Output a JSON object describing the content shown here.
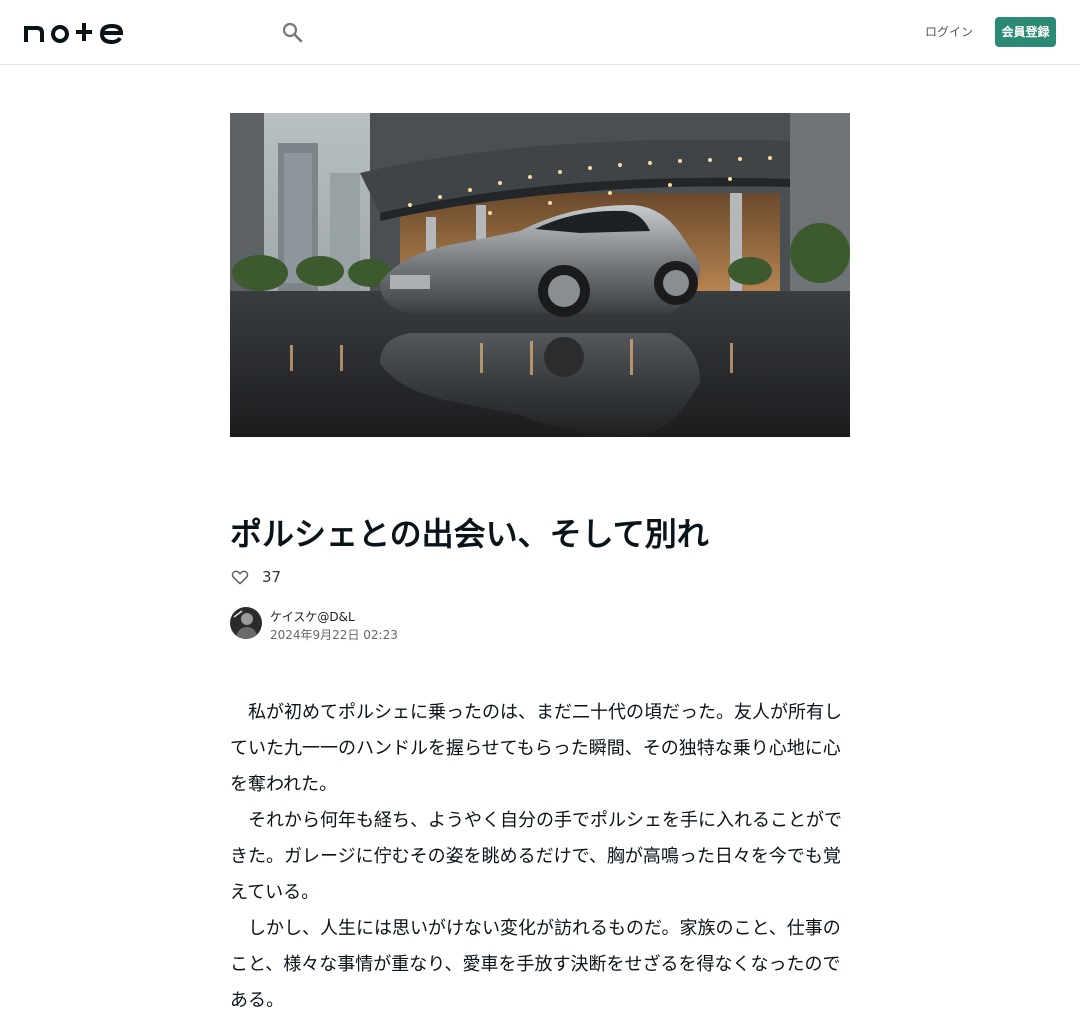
{
  "header": {
    "logo_text": "note",
    "login_label": "ログイン",
    "signup_label": "会員登録"
  },
  "article": {
    "title": "ポルシェとの出会い、そして別れ",
    "likes": "37",
    "author_name": "ケイスケ@D&L",
    "date": "2024年9月22日 02:23",
    "paragraphs": [
      "私が初めてポルシェに乗ったのは、まだ二十代の頃だった。友人が所有していた九一一のハンドルを握らせてもらった瞬間、その独特な乗り心地に心を奪われた。",
      "それから何年も経ち、ようやく自分の手でポルシェを手に入れることができた。ガレージに佇むその姿を眺めるだけで、胸が高鳴った日々を今でも覚えている。",
      "しかし、人生には思いがけない変化が訪れるものだ。家族のこと、仕事のこと、様々な事情が重なり、愛車を手放す決断をせざるを得なくなったのである。"
    ]
  },
  "icons": {
    "search": "search-icon",
    "heart": "heart-icon"
  },
  "colors": {
    "accent": "#2a8a74",
    "text": "#08131a"
  }
}
